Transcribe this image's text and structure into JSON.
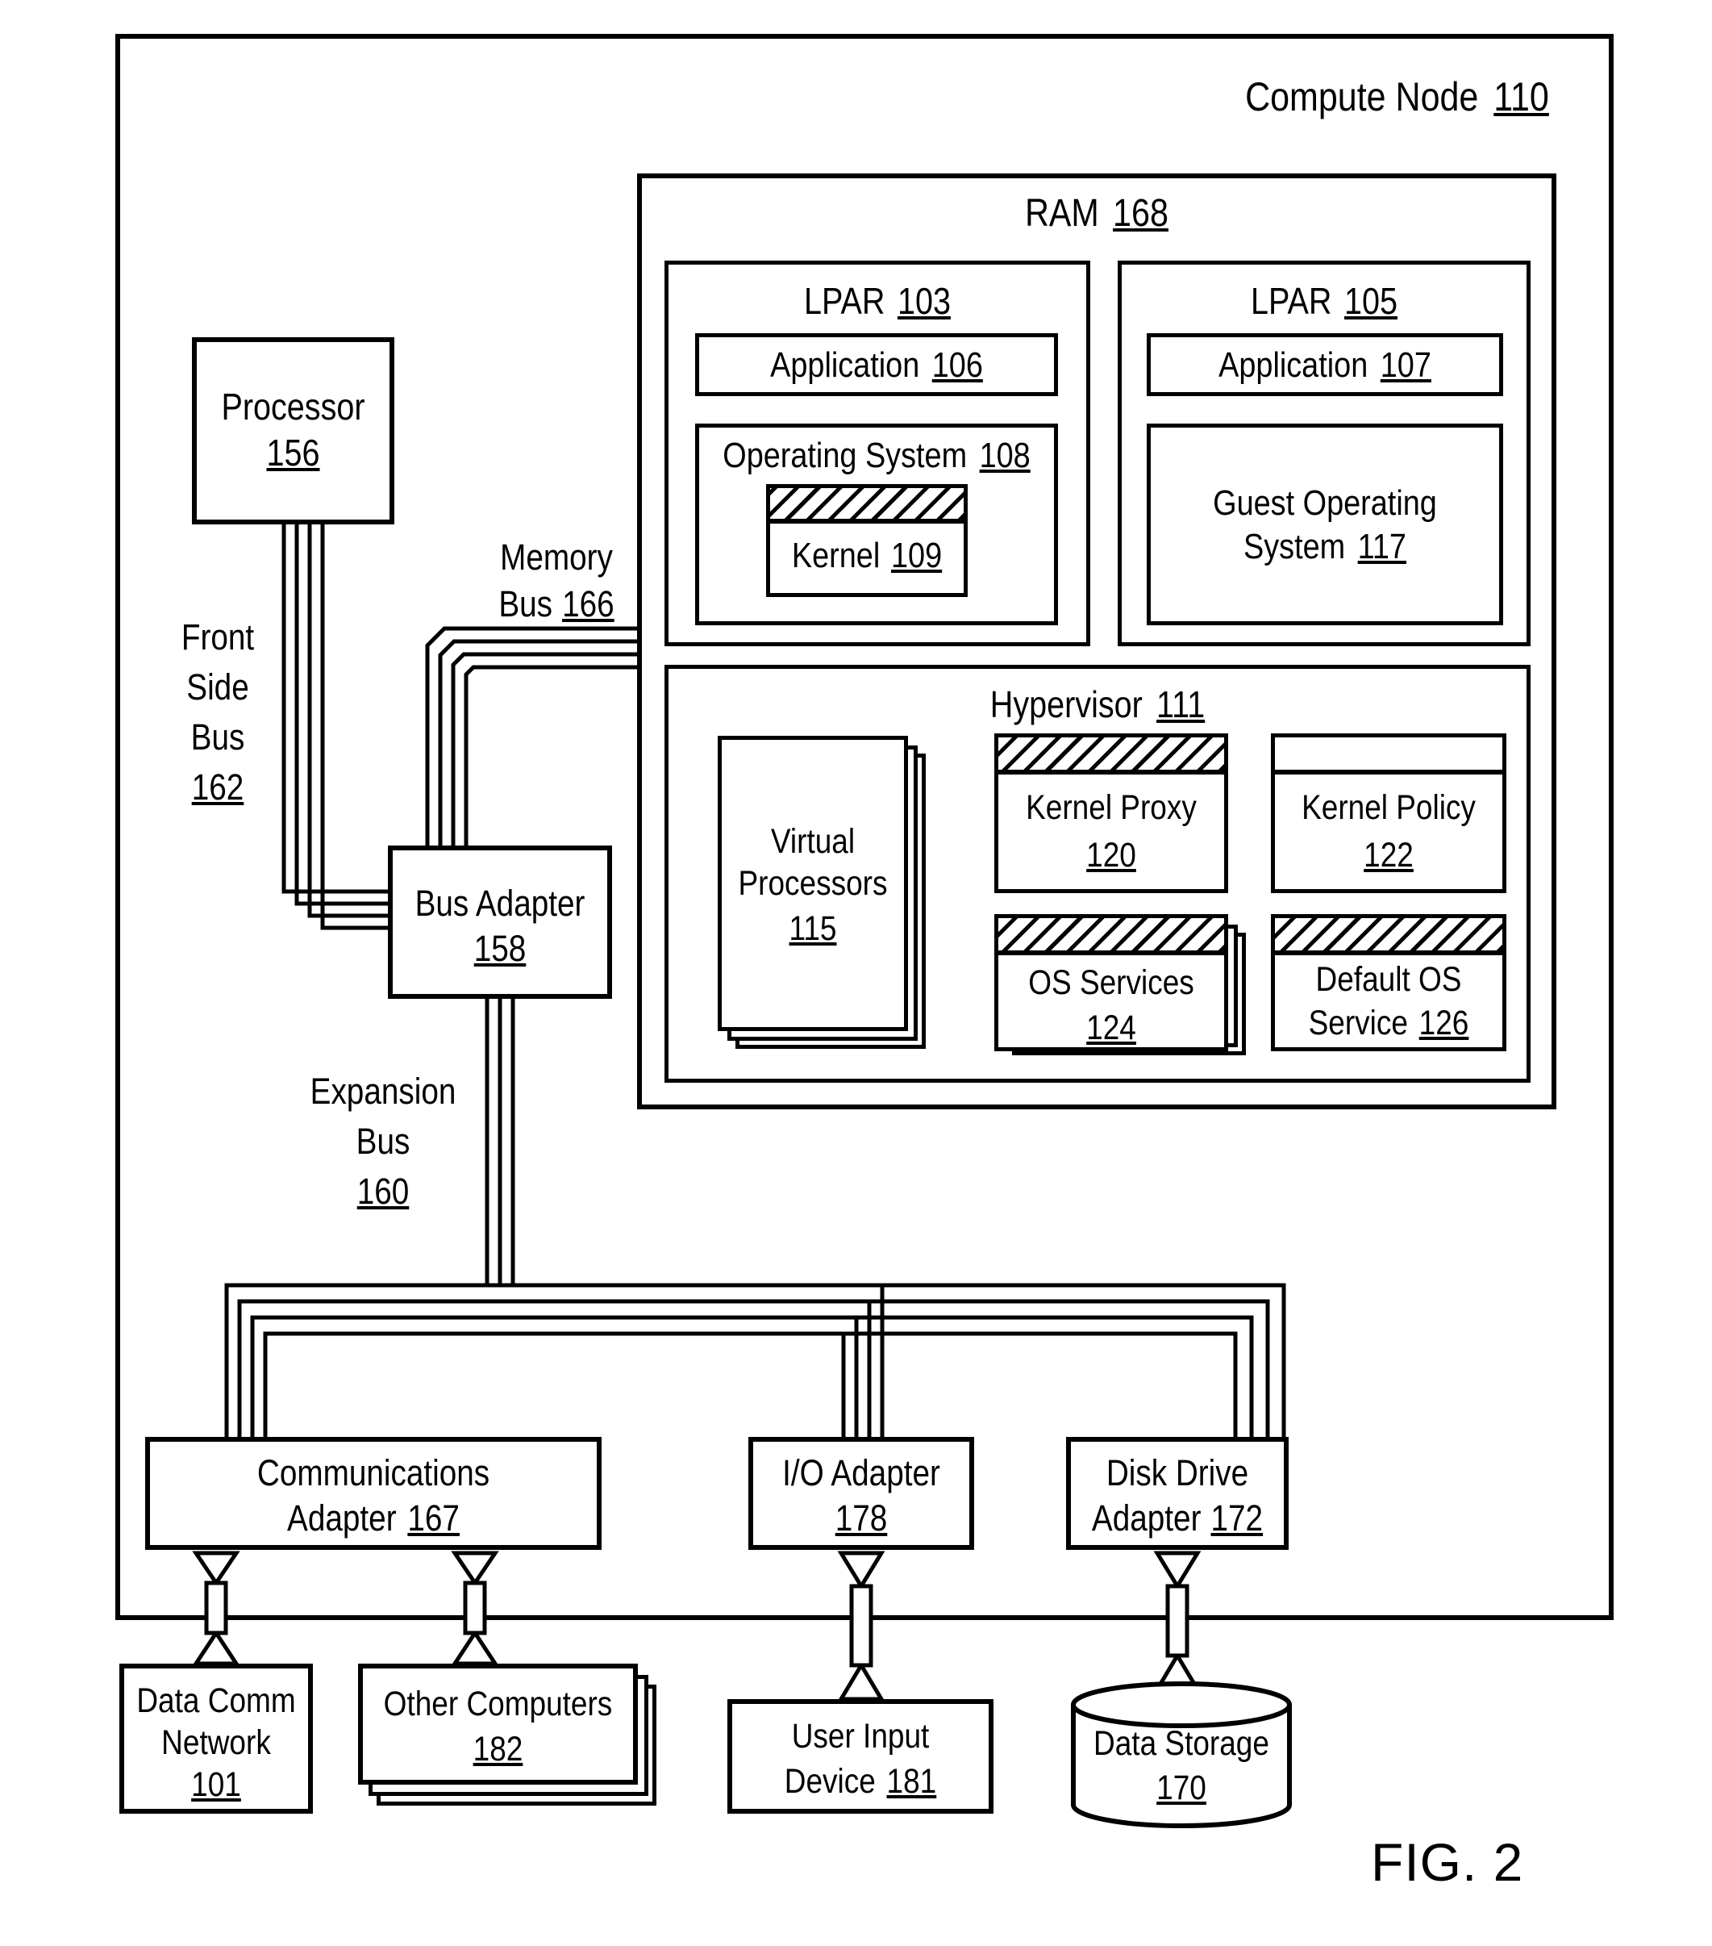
{
  "figure": {
    "caption": "FIG. 2"
  },
  "compute_node": {
    "title": "Compute Node",
    "ref": "110"
  },
  "processor": {
    "label": "Processor",
    "ref": "156"
  },
  "buses": {
    "front_side": {
      "label_lines": [
        "Front",
        "Side",
        "Bus"
      ],
      "ref": "162"
    },
    "memory": {
      "label_lines": [
        "Memory",
        "Bus"
      ],
      "ref": "166"
    },
    "expansion": {
      "label_lines": [
        "Expansion",
        "Bus"
      ],
      "ref": "160"
    }
  },
  "bus_adapter": {
    "label": "Bus Adapter",
    "ref": "158"
  },
  "ram": {
    "title": "RAM",
    "ref": "168",
    "lpars": [
      {
        "title": "LPAR",
        "ref": "103",
        "application": {
          "label": "Application",
          "ref": "106"
        },
        "operating_system": {
          "label": "Operating System",
          "ref": "108",
          "kernel": {
            "label": "Kernel",
            "ref": "109",
            "hatched_header": true
          }
        }
      },
      {
        "title": "LPAR",
        "ref": "105",
        "application": {
          "label": "Application",
          "ref": "107"
        },
        "guest_operating_system": {
          "label_lines": [
            "Guest Operating",
            "System"
          ],
          "ref": "117"
        }
      }
    ],
    "hypervisor": {
      "title": "Hypervisor",
      "ref": "111",
      "virtual_processors": {
        "label_lines": [
          "Virtual",
          "Processors"
        ],
        "ref": "115",
        "stacked": true
      },
      "kernel_proxy": {
        "label": "Kernel Proxy",
        "ref": "120",
        "hatched_header": true
      },
      "kernel_policy": {
        "label": "Kernel Policy",
        "ref": "122",
        "hatched_header": false
      },
      "os_services": {
        "label": "OS Services",
        "ref": "124",
        "hatched_header": true,
        "stacked": true
      },
      "default_os_service": {
        "label_lines": [
          "Default OS",
          "Service"
        ],
        "ref": "126",
        "hatched_header": true
      }
    }
  },
  "adapters": [
    {
      "label_lines": [
        "Communications",
        "Adapter"
      ],
      "ref": "167",
      "name": "communications-adapter"
    },
    {
      "label_lines": [
        "I/O Adapter"
      ],
      "ref": "178",
      "name": "io-adapter"
    },
    {
      "label_lines": [
        "Disk Drive",
        "Adapter"
      ],
      "ref": "172",
      "name": "disk-drive-adapter"
    }
  ],
  "peripherals": [
    {
      "label_lines": [
        "Data Comm",
        "Network"
      ],
      "ref": "101",
      "name": "data-comm-network",
      "shape": "box"
    },
    {
      "label_lines": [
        "Other Computers"
      ],
      "ref": "182",
      "name": "other-computers",
      "shape": "stacked-box"
    },
    {
      "label_lines": [
        "User Input",
        "Device"
      ],
      "ref": "181",
      "name": "user-input-device",
      "shape": "box"
    },
    {
      "label_lines": [
        "Data Storage"
      ],
      "ref": "170",
      "name": "data-storage",
      "shape": "cylinder"
    }
  ],
  "colors": {
    "line": "#000000",
    "fill": "#ffffff"
  }
}
